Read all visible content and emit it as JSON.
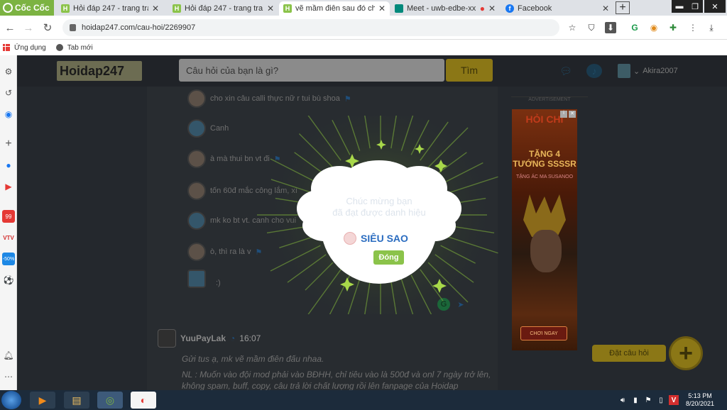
{
  "browser": {
    "brand": "Cốc Cốc",
    "tabs": [
      {
        "title": "Hỏi đáp 247 - trang tra l",
        "icon": "hoidap-favicon",
        "color": "#8bc34a",
        "letter": "H"
      },
      {
        "title": "Hỏi đáp 247 - trang tra l",
        "icon": "hoidap-favicon",
        "color": "#8bc34a",
        "letter": "H"
      },
      {
        "title": "vẽ mầm điên sau đó ch",
        "icon": "hoidap-favicon",
        "color": "#8bc34a",
        "letter": "H"
      },
      {
        "title": "Meet - uwb-edbe-xx",
        "icon": "meet-favicon",
        "color": "#00897b",
        "letter": ""
      },
      {
        "title": "Facebook",
        "icon": "facebook-favicon",
        "color": "#1877f2",
        "letter": "f"
      }
    ],
    "url": "hoidap247.com/cau-hoi/2269907",
    "bookmarks": {
      "apps": "Ứng dụng",
      "new_tab": "Tab mới"
    }
  },
  "site": {
    "logo": "Hoidap247",
    "search_placeholder": "Câu hỏi của bạn là gì?",
    "search_button": "Tìm",
    "username": "Akira2007"
  },
  "comments": [
    {
      "text": "cho xin câu calli thực nữ r tui bù shoa",
      "avatar": "tan",
      "flag": true
    },
    {
      "text": "Canh",
      "avatar": "blue",
      "flag": false
    },
    {
      "text": "à mà thui bn vt đi",
      "avatar": "tan",
      "flag": true
    },
    {
      "text": "tốn 60đ mắc công lắm, xì",
      "avatar": "tan",
      "flag": false
    },
    {
      "text": "mk ko bt vt. canh cho vui",
      "avatar": "blue",
      "flag": false
    },
    {
      "text": "ò, thì ra là v",
      "avatar": "tan",
      "flag": true
    },
    {
      "text": ":)",
      "avatar": "blue",
      "flag": false
    }
  ],
  "answer": {
    "author": "YuuPayLak",
    "time": "16:07",
    "line1": "Gửi tus ạ, mk vẽ mầm điên đấu nhaa.",
    "line2": "NL : Muốn vào đội mod phải vào BĐHH, chỉ tiêu vào là 500đ và onl 7 ngày trở lên, không spam, buff, copy, câu trả lời chất lượng rồi lên fanpage của Hoidap"
  },
  "ad": {
    "label": "ADVERTISEMENT",
    "title": "HỎI CHÍ",
    "headline": "TẶNG 4 TƯỚNG SSSSR",
    "sub": "TẶNG ÁC MA SUSANOO",
    "cta": "CHƠI NGAY"
  },
  "actions": {
    "ask": "Đặt câu hỏi",
    "plus": "+"
  },
  "popup": {
    "line1": "Chúc mừng bạn",
    "line2": "đã đạt được danh hiệu",
    "title": "SIÊU SAO",
    "close": "Đóng"
  },
  "taskbar": {
    "time": "5:13 PM",
    "date": "8/20/2021"
  }
}
